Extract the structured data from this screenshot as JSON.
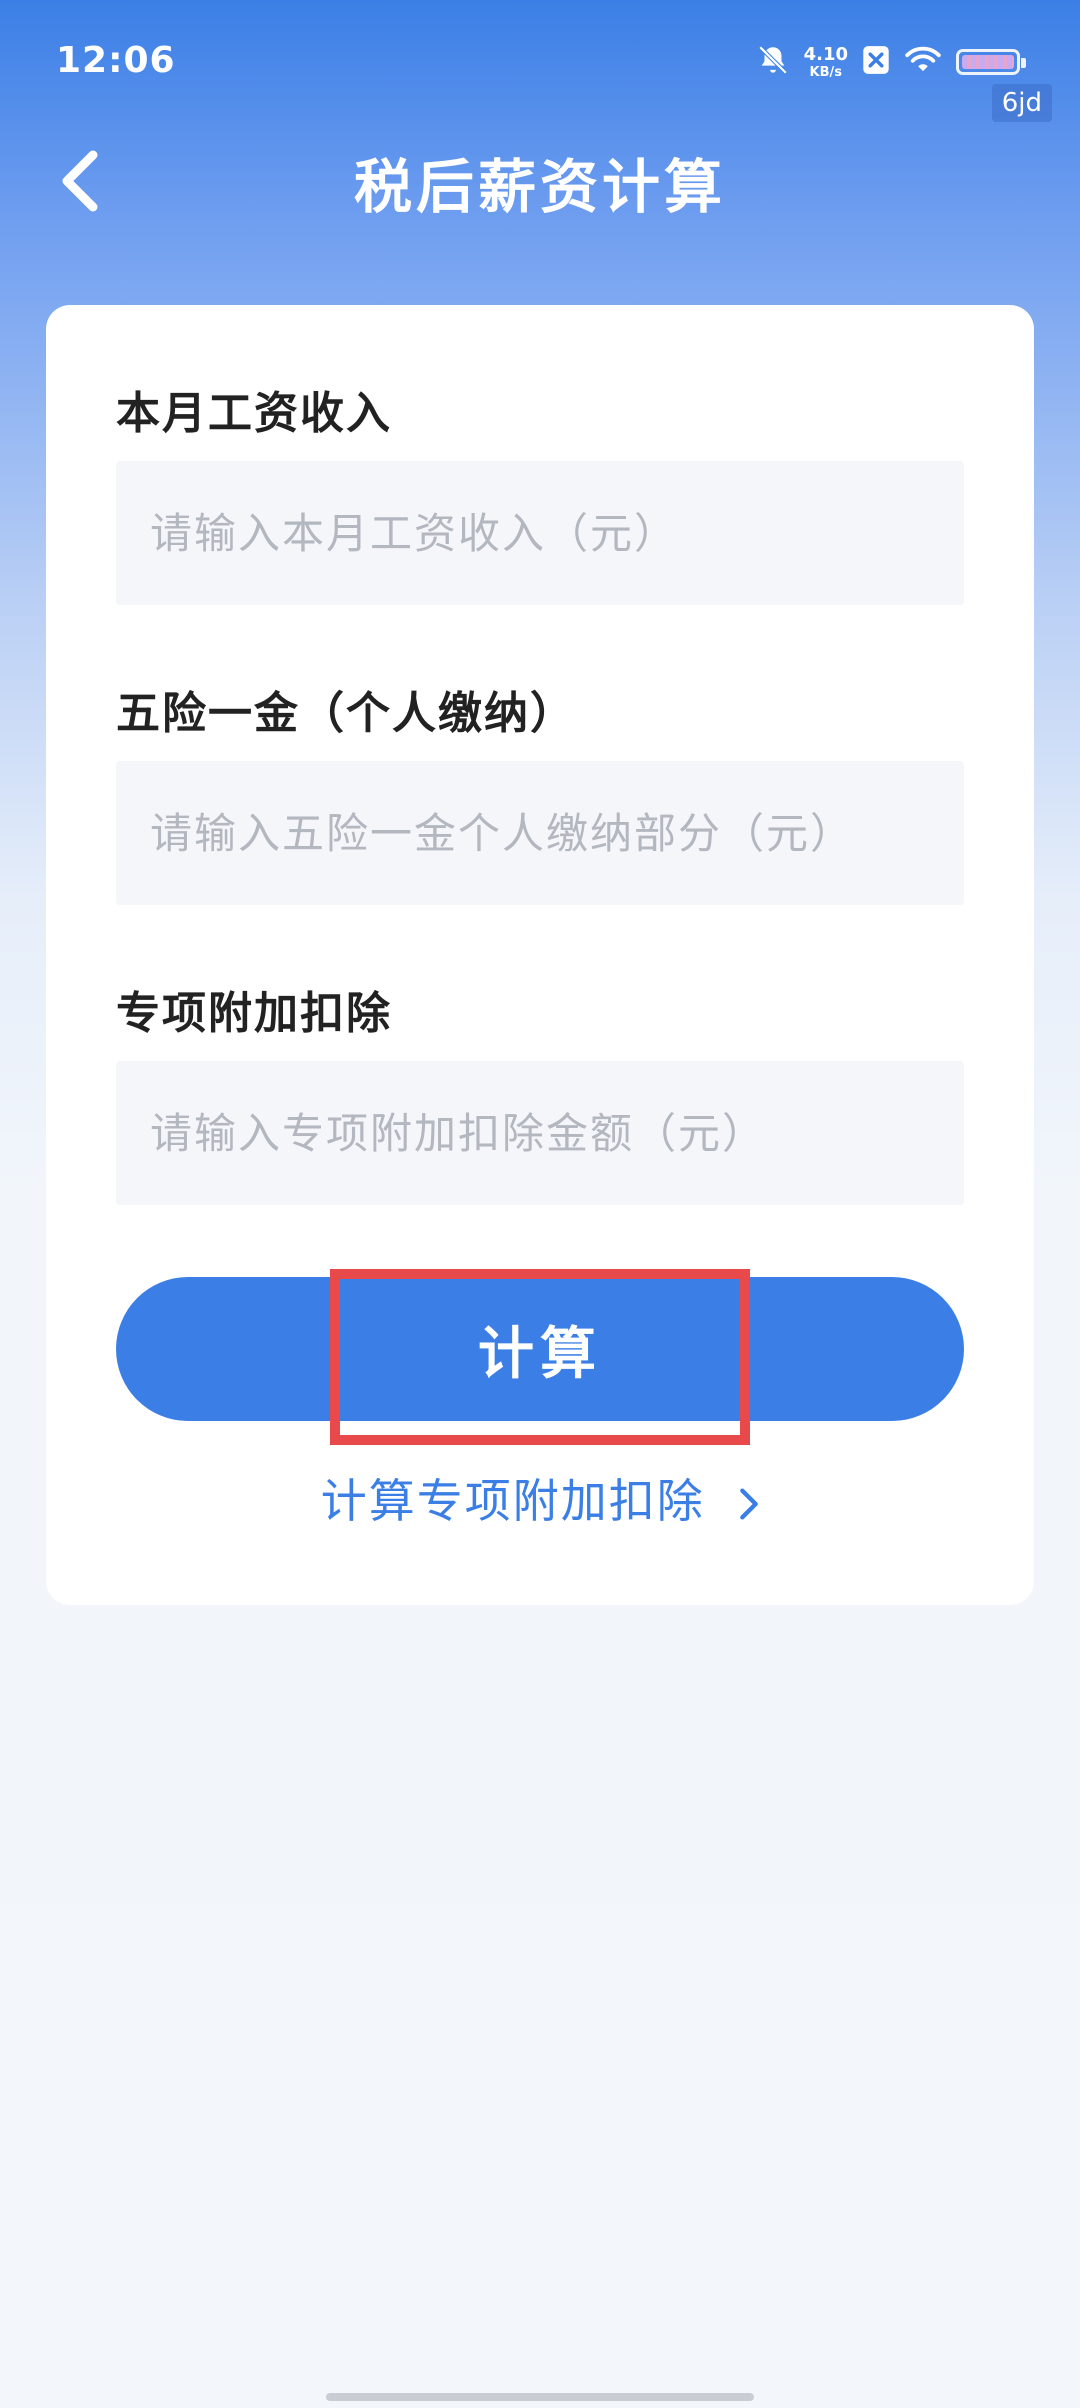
{
  "status_bar": {
    "time": "12:06",
    "net_speed": "4.10",
    "net_unit": "KB/s",
    "badge": "6jd"
  },
  "nav": {
    "title": "税后薪资计算"
  },
  "form": {
    "fields": [
      {
        "label": "本月工资收入",
        "placeholder": "请输入本月工资收入（元）",
        "value": ""
      },
      {
        "label": "五险一金（个人缴纳）",
        "placeholder": "请输入五险一金个人缴纳部分（元）",
        "value": ""
      },
      {
        "label": "专项附加扣除",
        "placeholder": "请输入专项附加扣除金额（元）",
        "value": ""
      }
    ],
    "calc_button": "计算",
    "link": "计算专项附加扣除"
  },
  "colors": {
    "accent": "#3b7fe6",
    "highlight": "#e8494b"
  }
}
